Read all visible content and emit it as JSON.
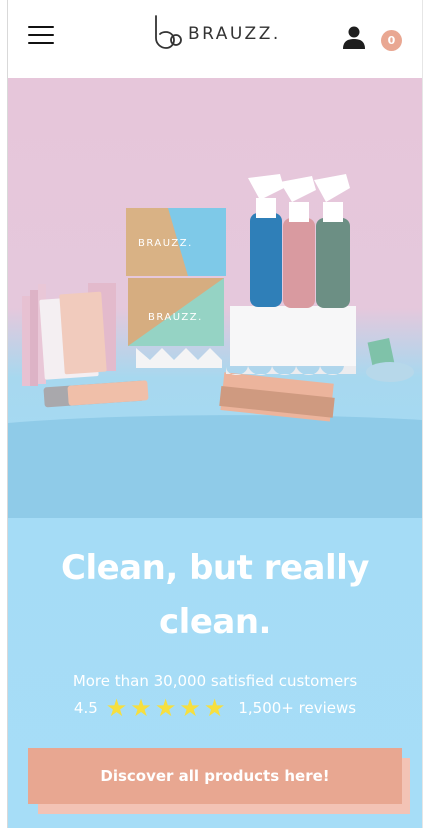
{
  "header": {
    "brand_name": "BRAUZZ.",
    "cart_count": "0"
  },
  "hero": {
    "headline_line1": "Clean, but really",
    "headline_line2": "clean.",
    "subtitle": "More than 30,000 satisfied customers",
    "rating_score": "4.5",
    "stars": 5,
    "reviews_label": "1,500+ reviews",
    "cta_label": "Discover all products here!",
    "box_brand": "BRAUZZ."
  },
  "colors": {
    "accent": "#e8a791",
    "hero_pink": "#e6c6da",
    "hero_blue": "#a6ddf7",
    "star": "#f6df3f"
  },
  "icons": [
    "menu-icon",
    "user-icon",
    "cart-count-badge",
    "star-icon"
  ]
}
